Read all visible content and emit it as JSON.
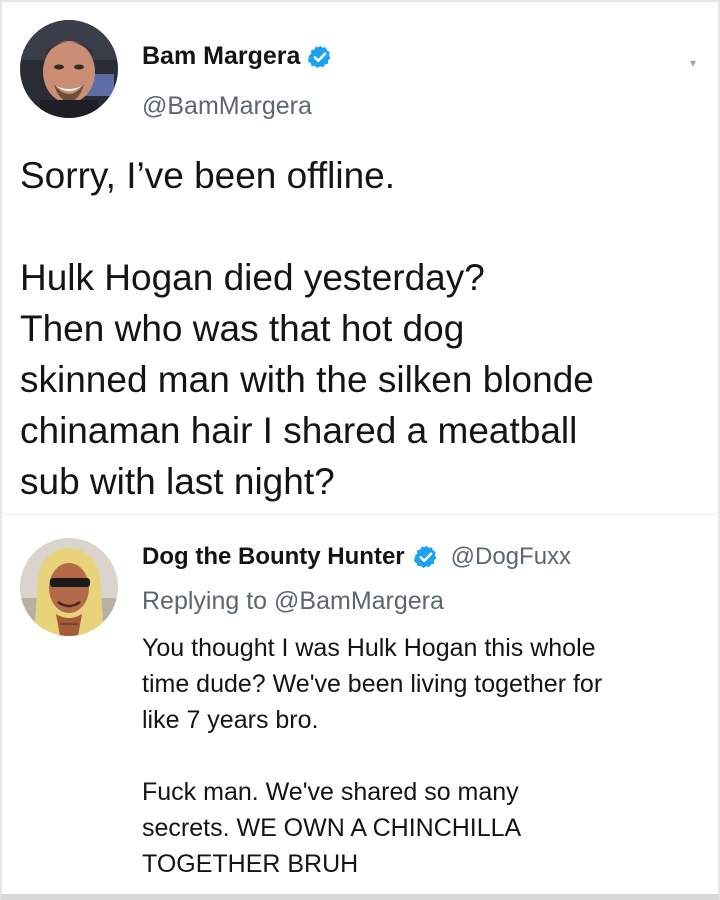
{
  "main_tweet": {
    "name": "Bam Margera",
    "handle": "@BamMargera",
    "text": "Sorry, I’ve been offline.\n\nHulk Hogan died yesterday?\nThen who was that hot dog\nskinned man with the silken blonde\nchinaman hair I shared a meatball\nsub with last night?",
    "verified_color": "#1da1f2",
    "avatar_icon": "bam-margera-avatar",
    "menu_icon": "chevron-down-icon"
  },
  "reply_tweet": {
    "name": "Dog the Bounty Hunter",
    "handle": "@DogFuxx",
    "replying_prefix": "Replying to",
    "replying_to": "@BamMargera",
    "text": "You thought I was Hulk Hogan this whole\ntime dude? We've been living together for\nlike 7 years bro.\n\nFuck man. We've shared so many\nsecrets. WE OWN A CHINCHILLA\nTOGETHER BRUH",
    "verified_color": "#1da1f2",
    "avatar_icon": "dog-bounty-hunter-avatar"
  }
}
